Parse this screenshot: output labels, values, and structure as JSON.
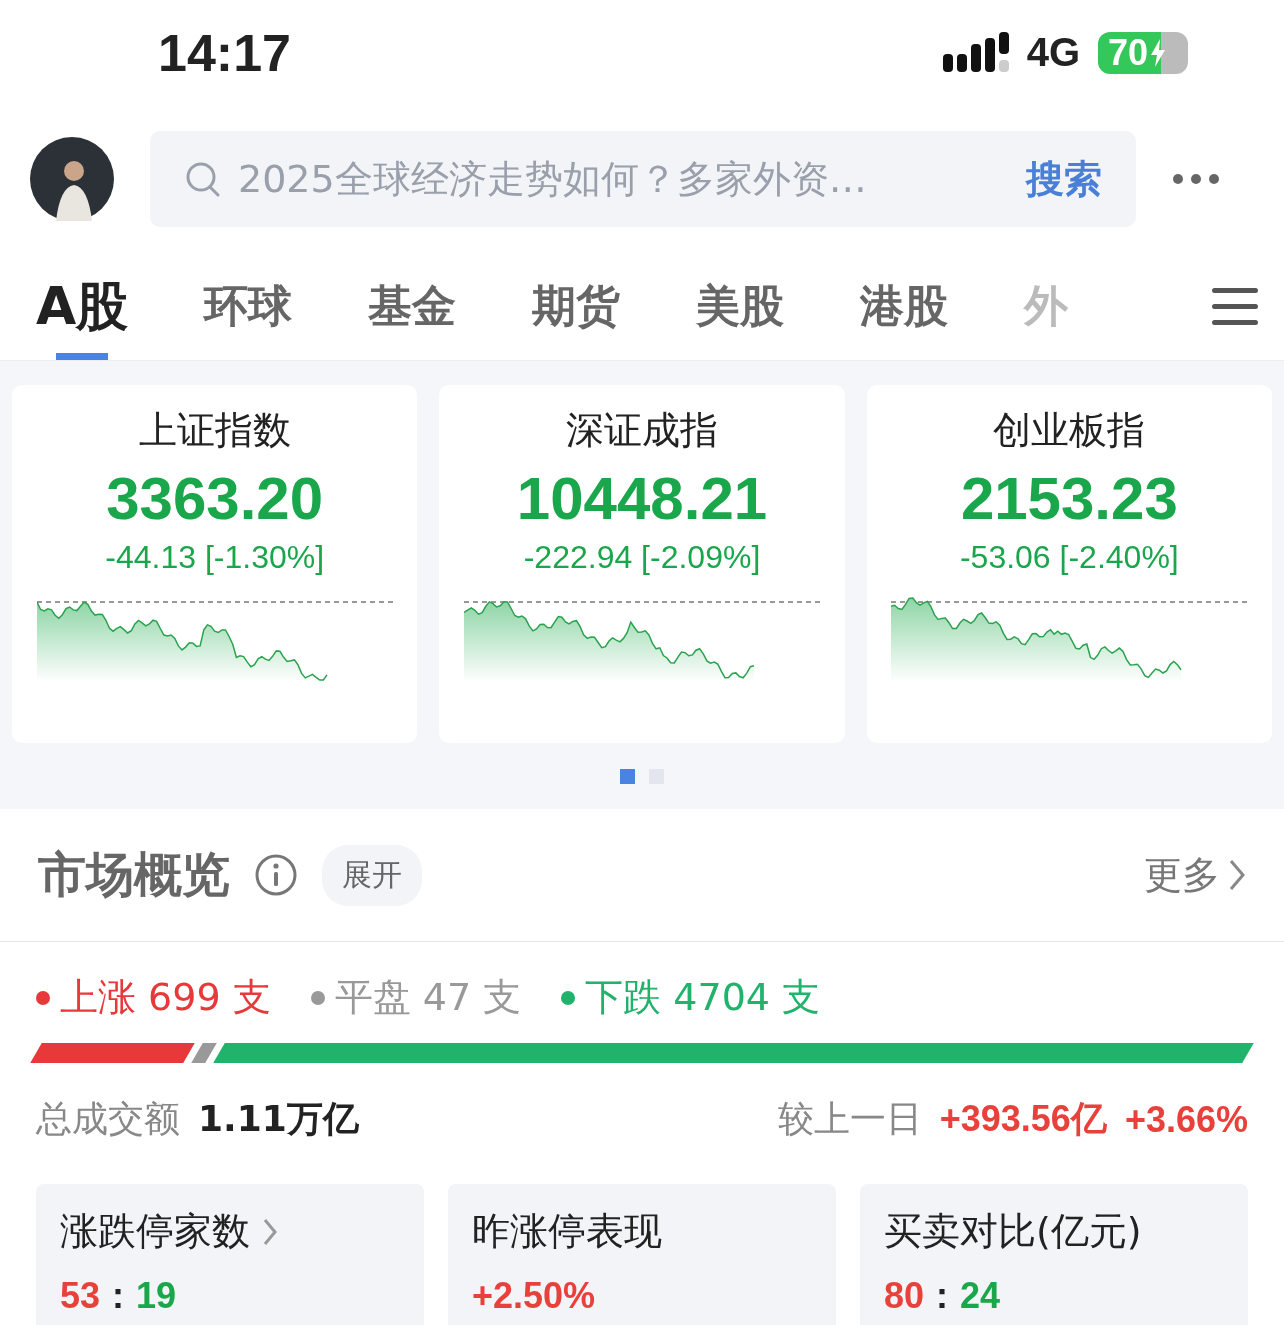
{
  "status_bar": {
    "time": "14:17",
    "network": "4G",
    "battery": "70"
  },
  "search": {
    "placeholder": "2025全球经济走势如何？多家外资…",
    "button": "搜索"
  },
  "tabs": [
    {
      "label": "A股",
      "selected": true
    },
    {
      "label": "环球",
      "selected": false
    },
    {
      "label": "基金",
      "selected": false
    },
    {
      "label": "期货",
      "selected": false
    },
    {
      "label": "美股",
      "selected": false
    },
    {
      "label": "港股",
      "selected": false
    },
    {
      "label": "外",
      "selected": false
    }
  ],
  "indices": [
    {
      "name": "上证指数",
      "value": "3363.20",
      "change": "-44.13 [-1.30%]"
    },
    {
      "name": "深证成指",
      "value": "10448.21",
      "change": "-222.94 [-2.09%]"
    },
    {
      "name": "创业板指",
      "value": "2153.23",
      "change": "-53.06 [-2.40%]"
    }
  ],
  "pager": [
    {
      "selected": true
    },
    {
      "selected": false
    }
  ],
  "overview": {
    "title": "市场概览",
    "expand": "展开",
    "more": "更多",
    "breadth": [
      {
        "label": "上涨",
        "count": "699",
        "unit": "支",
        "color": "#e8393a"
      },
      {
        "label": "平盘",
        "count": "47",
        "unit": "支",
        "color": "#999999"
      },
      {
        "label": "下跌",
        "count": "4704",
        "unit": "支",
        "color": "#21b36b"
      }
    ],
    "turnover_label": "总成交额",
    "turnover": "1.11万亿",
    "compare_label": "较上一日",
    "compare_amount": "+393.56亿",
    "compare_pct": "+3.66%",
    "stats": [
      {
        "title": "涨跌停家数",
        "link": true,
        "separator": ":",
        "parts": [
          {
            "text": "53",
            "color": "#e8403a"
          },
          {
            "text": "19",
            "color": "#1aa64a"
          }
        ]
      },
      {
        "title": "昨涨停表现",
        "link": false,
        "parts": [
          {
            "text": "+2.50%",
            "color": "#e8403a"
          }
        ]
      },
      {
        "title": "买卖对比(亿元)",
        "link": false,
        "separator": ":",
        "parts": [
          {
            "text": "80",
            "color": "#e8403a"
          },
          {
            "text": "24",
            "color": "#1aa64a"
          }
        ]
      }
    ]
  }
}
